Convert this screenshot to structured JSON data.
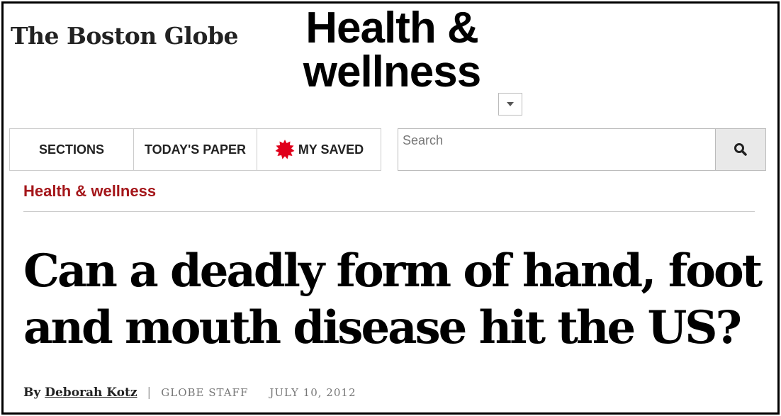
{
  "header": {
    "logo": "The Boston Globe",
    "section_title_line1": "Health &",
    "section_title_line2": "wellness"
  },
  "nav": {
    "sections": "SECTIONS",
    "todays_paper": "TODAY'S PAPER",
    "my_saved": "MY SAVED"
  },
  "search": {
    "placeholder": "Search",
    "button_icon": "search-icon"
  },
  "breadcrumb": "Health & wellness",
  "article": {
    "headline": "Can a deadly form of hand, foot and mouth disease hit the US?",
    "by": "By",
    "author": "Deborah Kotz",
    "separator": "|",
    "staff": "GLOBE STAFF",
    "date": "JULY 10, 2012"
  },
  "colors": {
    "accent": "#a4161a",
    "saved_star": "#e0001b"
  }
}
